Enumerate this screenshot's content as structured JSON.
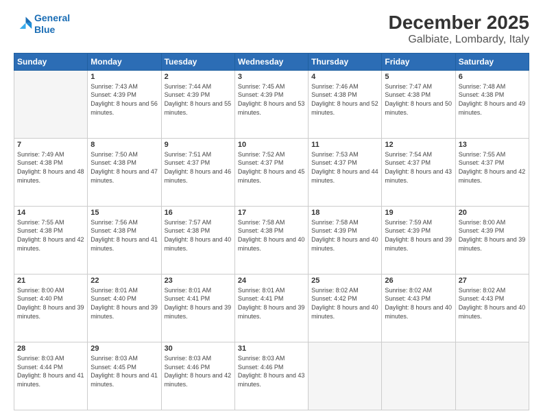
{
  "header": {
    "logo_line1": "General",
    "logo_line2": "Blue",
    "title": "December 2025",
    "subtitle": "Galbiate, Lombardy, Italy"
  },
  "days_of_week": [
    "Sunday",
    "Monday",
    "Tuesday",
    "Wednesday",
    "Thursday",
    "Friday",
    "Saturday"
  ],
  "weeks": [
    [
      {
        "num": "",
        "empty": true
      },
      {
        "num": "1",
        "sunrise": "Sunrise: 7:43 AM",
        "sunset": "Sunset: 4:39 PM",
        "daylight": "Daylight: 8 hours and 56 minutes."
      },
      {
        "num": "2",
        "sunrise": "Sunrise: 7:44 AM",
        "sunset": "Sunset: 4:39 PM",
        "daylight": "Daylight: 8 hours and 55 minutes."
      },
      {
        "num": "3",
        "sunrise": "Sunrise: 7:45 AM",
        "sunset": "Sunset: 4:39 PM",
        "daylight": "Daylight: 8 hours and 53 minutes."
      },
      {
        "num": "4",
        "sunrise": "Sunrise: 7:46 AM",
        "sunset": "Sunset: 4:38 PM",
        "daylight": "Daylight: 8 hours and 52 minutes."
      },
      {
        "num": "5",
        "sunrise": "Sunrise: 7:47 AM",
        "sunset": "Sunset: 4:38 PM",
        "daylight": "Daylight: 8 hours and 50 minutes."
      },
      {
        "num": "6",
        "sunrise": "Sunrise: 7:48 AM",
        "sunset": "Sunset: 4:38 PM",
        "daylight": "Daylight: 8 hours and 49 minutes."
      }
    ],
    [
      {
        "num": "7",
        "sunrise": "Sunrise: 7:49 AM",
        "sunset": "Sunset: 4:38 PM",
        "daylight": "Daylight: 8 hours and 48 minutes."
      },
      {
        "num": "8",
        "sunrise": "Sunrise: 7:50 AM",
        "sunset": "Sunset: 4:38 PM",
        "daylight": "Daylight: 8 hours and 47 minutes."
      },
      {
        "num": "9",
        "sunrise": "Sunrise: 7:51 AM",
        "sunset": "Sunset: 4:37 PM",
        "daylight": "Daylight: 8 hours and 46 minutes."
      },
      {
        "num": "10",
        "sunrise": "Sunrise: 7:52 AM",
        "sunset": "Sunset: 4:37 PM",
        "daylight": "Daylight: 8 hours and 45 minutes."
      },
      {
        "num": "11",
        "sunrise": "Sunrise: 7:53 AM",
        "sunset": "Sunset: 4:37 PM",
        "daylight": "Daylight: 8 hours and 44 minutes."
      },
      {
        "num": "12",
        "sunrise": "Sunrise: 7:54 AM",
        "sunset": "Sunset: 4:37 PM",
        "daylight": "Daylight: 8 hours and 43 minutes."
      },
      {
        "num": "13",
        "sunrise": "Sunrise: 7:55 AM",
        "sunset": "Sunset: 4:37 PM",
        "daylight": "Daylight: 8 hours and 42 minutes."
      }
    ],
    [
      {
        "num": "14",
        "sunrise": "Sunrise: 7:55 AM",
        "sunset": "Sunset: 4:38 PM",
        "daylight": "Daylight: 8 hours and 42 minutes."
      },
      {
        "num": "15",
        "sunrise": "Sunrise: 7:56 AM",
        "sunset": "Sunset: 4:38 PM",
        "daylight": "Daylight: 8 hours and 41 minutes."
      },
      {
        "num": "16",
        "sunrise": "Sunrise: 7:57 AM",
        "sunset": "Sunset: 4:38 PM",
        "daylight": "Daylight: 8 hours and 40 minutes."
      },
      {
        "num": "17",
        "sunrise": "Sunrise: 7:58 AM",
        "sunset": "Sunset: 4:38 PM",
        "daylight": "Daylight: 8 hours and 40 minutes."
      },
      {
        "num": "18",
        "sunrise": "Sunrise: 7:58 AM",
        "sunset": "Sunset: 4:39 PM",
        "daylight": "Daylight: 8 hours and 40 minutes."
      },
      {
        "num": "19",
        "sunrise": "Sunrise: 7:59 AM",
        "sunset": "Sunset: 4:39 PM",
        "daylight": "Daylight: 8 hours and 39 minutes."
      },
      {
        "num": "20",
        "sunrise": "Sunrise: 8:00 AM",
        "sunset": "Sunset: 4:39 PM",
        "daylight": "Daylight: 8 hours and 39 minutes."
      }
    ],
    [
      {
        "num": "21",
        "sunrise": "Sunrise: 8:00 AM",
        "sunset": "Sunset: 4:40 PM",
        "daylight": "Daylight: 8 hours and 39 minutes."
      },
      {
        "num": "22",
        "sunrise": "Sunrise: 8:01 AM",
        "sunset": "Sunset: 4:40 PM",
        "daylight": "Daylight: 8 hours and 39 minutes."
      },
      {
        "num": "23",
        "sunrise": "Sunrise: 8:01 AM",
        "sunset": "Sunset: 4:41 PM",
        "daylight": "Daylight: 8 hours and 39 minutes."
      },
      {
        "num": "24",
        "sunrise": "Sunrise: 8:01 AM",
        "sunset": "Sunset: 4:41 PM",
        "daylight": "Daylight: 8 hours and 39 minutes."
      },
      {
        "num": "25",
        "sunrise": "Sunrise: 8:02 AM",
        "sunset": "Sunset: 4:42 PM",
        "daylight": "Daylight: 8 hours and 40 minutes."
      },
      {
        "num": "26",
        "sunrise": "Sunrise: 8:02 AM",
        "sunset": "Sunset: 4:43 PM",
        "daylight": "Daylight: 8 hours and 40 minutes."
      },
      {
        "num": "27",
        "sunrise": "Sunrise: 8:02 AM",
        "sunset": "Sunset: 4:43 PM",
        "daylight": "Daylight: 8 hours and 40 minutes."
      }
    ],
    [
      {
        "num": "28",
        "sunrise": "Sunrise: 8:03 AM",
        "sunset": "Sunset: 4:44 PM",
        "daylight": "Daylight: 8 hours and 41 minutes."
      },
      {
        "num": "29",
        "sunrise": "Sunrise: 8:03 AM",
        "sunset": "Sunset: 4:45 PM",
        "daylight": "Daylight: 8 hours and 41 minutes."
      },
      {
        "num": "30",
        "sunrise": "Sunrise: 8:03 AM",
        "sunset": "Sunset: 4:46 PM",
        "daylight": "Daylight: 8 hours and 42 minutes."
      },
      {
        "num": "31",
        "sunrise": "Sunrise: 8:03 AM",
        "sunset": "Sunset: 4:46 PM",
        "daylight": "Daylight: 8 hours and 43 minutes."
      },
      {
        "num": "",
        "empty": true
      },
      {
        "num": "",
        "empty": true
      },
      {
        "num": "",
        "empty": true
      }
    ]
  ]
}
